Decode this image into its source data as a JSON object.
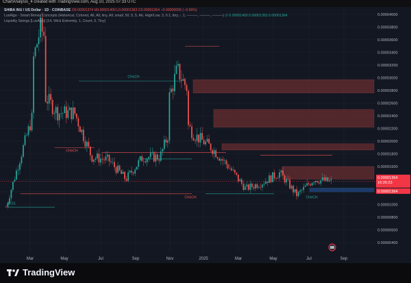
{
  "header": {
    "title": "ChartAnalysis_4 created with TradingView.com, Aug 10, 2025 07:33 UTC"
  },
  "legend": {
    "symbol": "SHIBA INU / US Dollar · 1D · COINBASE",
    "ohlc": "O0.00001374 H0.00001400 L0.00001363 C0.00001364 −0.00000009 (−0.66%)",
    "indicator1": "LuxAlgo - Smart Money Concepts (Historical, Colored, All, All, tiny, All, small, 50, 5, 5, Atr, High/Low, 3, 0.1, tiny, -, 1, ———, ———, ———)",
    "indicator1_values": "∅  0.00001400  0.00001363  0.00001364",
    "indicator2": "Liquidity Swings [LuxAlgo] (14, Wick Extremity, 1, Count, 0, Tiny)"
  },
  "price_axis": {
    "labels": [
      "0.00004000",
      "0.00003800",
      "0.00003600",
      "0.00003400",
      "0.00003200",
      "0.00003000",
      "0.00002800",
      "0.00002600",
      "0.00002400",
      "0.00002200",
      "0.00002000",
      "0.00001800",
      "0.00001600",
      "0.00001400",
      "0.00001200",
      "0.00001000",
      "0.00000800",
      "0.00000600",
      "0.00000400"
    ],
    "current_price": "0.00001364",
    "countdown": "16:26:23",
    "second_tag": "0.00001364"
  },
  "time_axis": {
    "labels": [
      "Mar",
      "May",
      "Jul",
      "Sep",
      "Nov",
      "2025",
      "Mar",
      "May",
      "Jul",
      "Sep"
    ]
  },
  "footer": {
    "brand": "TradingView"
  },
  "annotations": {
    "choch_labels": [
      "CHoCH",
      "CHoCH",
      "CHoCH",
      "CHoCH"
    ],
    "bos_label": "BOS"
  },
  "colors": {
    "up": "#26a69a",
    "down": "#ef5350",
    "supply_zone": "#5d2a2e",
    "demand_zone": "#1c4a47",
    "price_tag": "#f23645"
  },
  "chart_data": {
    "type": "candlestick",
    "title": "SHIBA INU / US Dollar · 1D · COINBASE",
    "y_scale": "linear",
    "ylim": [
      3e-06,
      4.1e-05
    ],
    "x_range": [
      "2024-01-10",
      "2025-09-20"
    ],
    "monthly_closes_approx": [
      {
        "month": "2024-01",
        "close": 9.6e-06
      },
      {
        "month": "2024-02",
        "close": 1.9e-05
      },
      {
        "month": "2024-03",
        "close": 2.8e-05
      },
      {
        "month": "2024-04",
        "close": 2.45e-05
      },
      {
        "month": "2024-05",
        "close": 2.45e-05
      },
      {
        "month": "2024-06",
        "close": 1.75e-05
      },
      {
        "month": "2024-07",
        "close": 1.7e-05
      },
      {
        "month": "2024-08",
        "close": 1.4e-05
      },
      {
        "month": "2024-09",
        "close": 1.75e-05
      },
      {
        "month": "2024-10",
        "close": 1.75e-05
      },
      {
        "month": "2024-11",
        "close": 2.5e-05
      },
      {
        "month": "2024-12",
        "close": 2.1e-05
      },
      {
        "month": "2025-01",
        "close": 1.9e-05
      },
      {
        "month": "2025-02",
        "close": 1.6e-05
      },
      {
        "month": "2025-03",
        "close": 1.25e-05
      },
      {
        "month": "2025-04",
        "close": 1.35e-05
      },
      {
        "month": "2025-05",
        "close": 1.5e-05
      },
      {
        "month": "2025-06",
        "close": 1.15e-05
      },
      {
        "month": "2025-07",
        "close": 1.4e-05
      },
      {
        "month": "2025-08",
        "close": 1.36e-05
      }
    ],
    "last": {
      "open": 1.374e-05,
      "high": 1.4e-05,
      "low": 1.363e-05,
      "close": 1.364e-05,
      "change": -9e-08,
      "change_pct": -0.66
    },
    "zones": [
      {
        "type": "supply",
        "top": 2.97e-05,
        "bottom": 2.76e-05
      },
      {
        "type": "supply",
        "top": 2.5e-05,
        "bottom": 2.22e-05
      },
      {
        "type": "supply",
        "top": 1.96e-05,
        "bottom": 1.86e-05
      },
      {
        "type": "supply",
        "top": 1.6e-05,
        "bottom": 1.4e-05
      },
      {
        "type": "demand",
        "top": 1.26e-05,
        "bottom": 1.2e-05
      }
    ]
  }
}
